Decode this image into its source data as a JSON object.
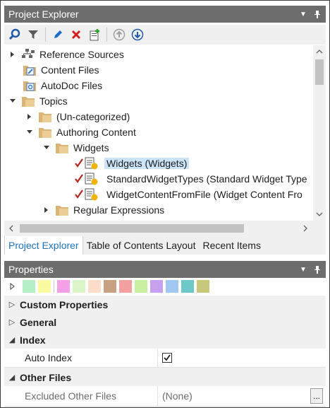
{
  "explorer": {
    "title": "Project Explorer",
    "tree": [
      {
        "label": "Reference Sources",
        "icon": "reference-sources-icon"
      },
      {
        "label": "Content Files",
        "icon": "content-files-icon"
      },
      {
        "label": "AutoDoc Files",
        "icon": "autodoc-files-icon"
      },
      {
        "label": "Topics",
        "icon": "folder-icon"
      },
      {
        "label": "(Un-categorized)",
        "icon": "folder-icon"
      },
      {
        "label": "Authoring Content",
        "icon": "folder-icon"
      },
      {
        "label": "Widgets",
        "icon": "folder-icon"
      },
      {
        "label": "Widgets (Widgets)",
        "icon": "topic-icon"
      },
      {
        "label": "StandardWidgetTypes (Standard Widget Type",
        "icon": "topic-icon"
      },
      {
        "label": "WidgetContentFromFile (Widget Content Fro",
        "icon": "topic-icon"
      },
      {
        "label": "Regular Expressions",
        "icon": "folder-icon"
      }
    ]
  },
  "tabs": [
    "Project Explorer",
    "Table of Contents Layout",
    "Recent Items"
  ],
  "properties": {
    "title": "Properties",
    "swatches": [
      "#b5f0c8",
      "#fafaa0",
      "#f5a0e6",
      "#dcf5c8",
      "#fadcc8",
      "#c8a082",
      "#f5a0a0",
      "#c8f0a0",
      "#c8a0f0",
      "#a0c8f0",
      "#6ec8c8",
      "#c8c87d"
    ],
    "categories": {
      "custom": "Custom Properties",
      "general": "General",
      "index": "Index",
      "other": "Other Files"
    },
    "rows": {
      "auto_index": {
        "name": "Auto Index",
        "checked": true
      },
      "excluded": {
        "name": "Excluded Other Files",
        "value": "(None)",
        "button": "..."
      }
    }
  }
}
